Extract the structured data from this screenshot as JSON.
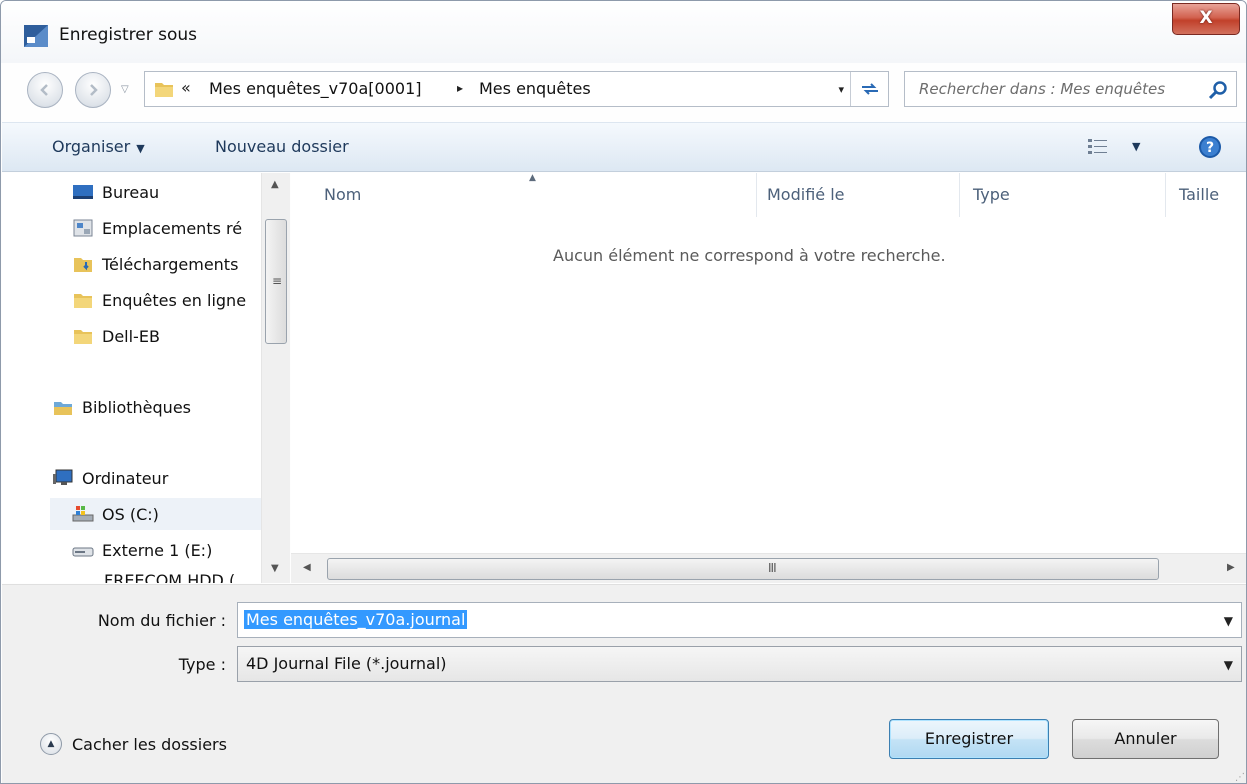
{
  "window": {
    "title": "Enregistrer sous",
    "close_label": "X"
  },
  "address": {
    "overflow": "«",
    "crumbs": [
      "Mes enquêtes_v70a[0001]",
      "Mes enquêtes"
    ],
    "separator": "▸",
    "dropdown": "▾"
  },
  "search": {
    "placeholder": "Rechercher dans : Mes enquêtes"
  },
  "toolbar": {
    "organize_label": "Organiser",
    "new_folder_label": "Nouveau dossier"
  },
  "sidebar": {
    "items": [
      {
        "label": "Bureau",
        "icon": "desktop-icon"
      },
      {
        "label": "Emplacements ré",
        "icon": "recent-places-icon"
      },
      {
        "label": "Téléchargements",
        "icon": "downloads-folder-icon"
      },
      {
        "label": "Enquêtes en ligne",
        "icon": "folder-icon"
      },
      {
        "label": "Dell-EB",
        "icon": "folder-icon"
      },
      {
        "label": "Bibliothèques",
        "icon": "libraries-icon"
      },
      {
        "label": "Ordinateur",
        "icon": "computer-icon"
      },
      {
        "label": "OS (C:)",
        "icon": "system-drive-icon"
      },
      {
        "label": "Externe 1 (E:)",
        "icon": "external-drive-icon"
      },
      {
        "label": "FREECOM HDD (",
        "icon": "external-drive-icon"
      }
    ]
  },
  "filelist": {
    "columns": [
      "Nom",
      "Modifié le",
      "Type",
      "Taille"
    ],
    "empty_message": "Aucun élément ne correspond à votre recherche."
  },
  "form": {
    "filename_label": "Nom du fichier :",
    "filename_value": "Mes enquêtes_v70a.journal",
    "type_label": "Type :",
    "type_value": "4D Journal File (*.journal)"
  },
  "footer": {
    "hide_folders_label": "Cacher les dossiers",
    "save_label": "Enregistrer",
    "cancel_label": "Annuler"
  },
  "colors": {
    "toolbar_text": "#1e395b",
    "selection": "#3399ff",
    "close_button": "#c1402a"
  }
}
